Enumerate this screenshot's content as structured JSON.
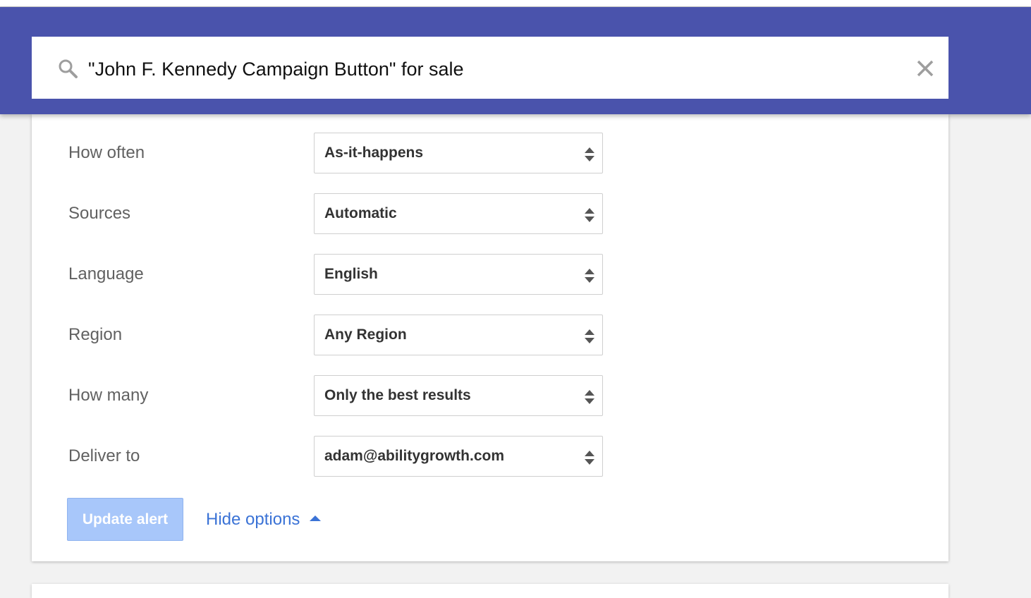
{
  "search": {
    "query": "\"John F. Kennedy Campaign Button\" for sale",
    "search_icon": "search-icon",
    "clear_icon": "close-icon"
  },
  "options": [
    {
      "label": "How often",
      "value": "As-it-happens"
    },
    {
      "label": "Sources",
      "value": "Automatic"
    },
    {
      "label": "Language",
      "value": "English"
    },
    {
      "label": "Region",
      "value": "Any Region"
    },
    {
      "label": "How many",
      "value": "Only the best results"
    },
    {
      "label": "Deliver to",
      "value": "adam@abilitygrowth.com"
    }
  ],
  "actions": {
    "update_label": "Update alert",
    "hide_options_label": "Hide options"
  },
  "colors": {
    "header": "#4a53ac",
    "link": "#3b73d6",
    "button_disabled": "#a8c7fa"
  }
}
